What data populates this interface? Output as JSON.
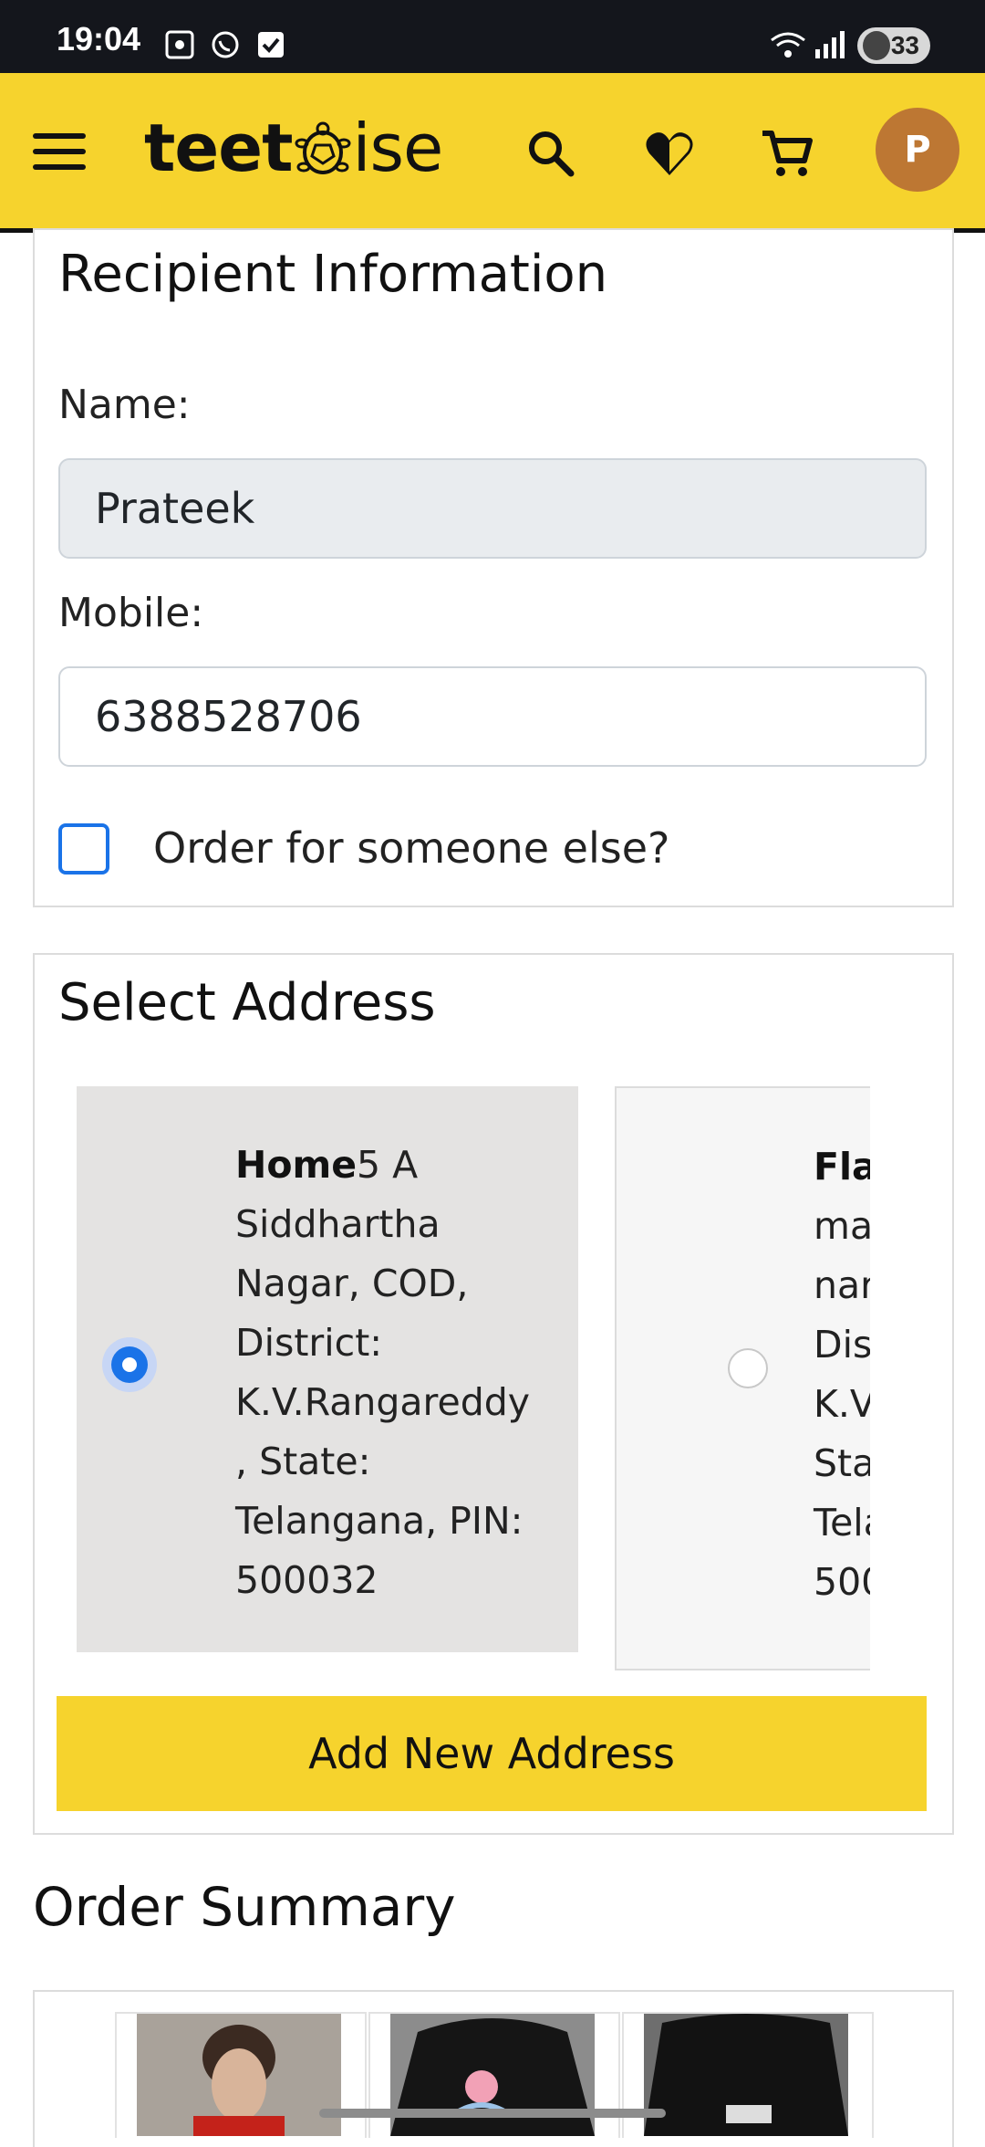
{
  "status_bar": {
    "time": "19:04",
    "battery": "33"
  },
  "header": {
    "logo_part1": "teet",
    "logo_part2": "ise",
    "avatar_initial": "P"
  },
  "recipient": {
    "title": "Recipient Information",
    "name_label": "Name:",
    "name_value": "Prateek",
    "mobile_label": "Mobile:",
    "mobile_value": "6388528706",
    "someone_else_label": "Order for someone else?"
  },
  "address": {
    "title": "Select Address",
    "items": [
      {
        "type": "Home",
        "text": "5 A Siddhartha Nagar, COD, District: K.V.Rangareddy, State: Telangana, PIN: 500032",
        "selected": true
      },
      {
        "type": "Fla",
        "lines": [
          "mar",
          "nar",
          "Dis",
          "K.V.",
          "Sta",
          "Tela",
          "500"
        ],
        "selected": false
      }
    ],
    "add_button": "Add New Address"
  },
  "order_summary": {
    "title": "Order Summary"
  },
  "colors": {
    "brand_yellow": "#f6d32d",
    "radio_blue": "#1a73e8"
  }
}
